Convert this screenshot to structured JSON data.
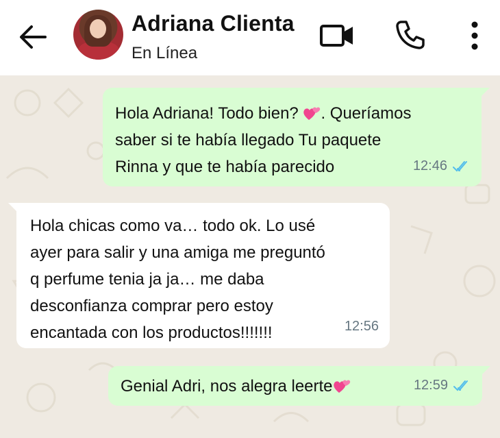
{
  "header": {
    "contact_name": "Adriana Clienta",
    "status": "En Línea",
    "icons": {
      "back": "arrow-left-icon",
      "video": "video-call-icon",
      "call": "phone-icon",
      "more": "more-vertical-icon"
    }
  },
  "colors": {
    "header_bg": "#ffffff",
    "chat_bg": "#efeae2",
    "outgoing_bubble": "#d9fdd3",
    "incoming_bubble": "#ffffff",
    "read_ticks": "#53bdeb"
  },
  "messages": [
    {
      "direction": "outgoing",
      "text_before_emoji": "Hola Adriana! Todo bien? ",
      "emoji": "two-hearts",
      "text_after_emoji": ". Queríamos\nsaber si te había llegado Tu paquete\nRinna y que te había parecido",
      "time": "12:46",
      "status": "read"
    },
    {
      "direction": "incoming",
      "text": "Hola chicas como va… todo ok. Lo usé\nayer para salir y una amiga me preguntó\nq perfume tenia ja ja… me daba\ndesconfianza comprar pero estoy\nencantada con los productos!!!!!!!",
      "time": "12:56"
    },
    {
      "direction": "outgoing",
      "text_before_emoji": "Genial Adri, nos alegra leerte",
      "emoji": "two-hearts",
      "time": "12:59",
      "status": "read"
    }
  ]
}
